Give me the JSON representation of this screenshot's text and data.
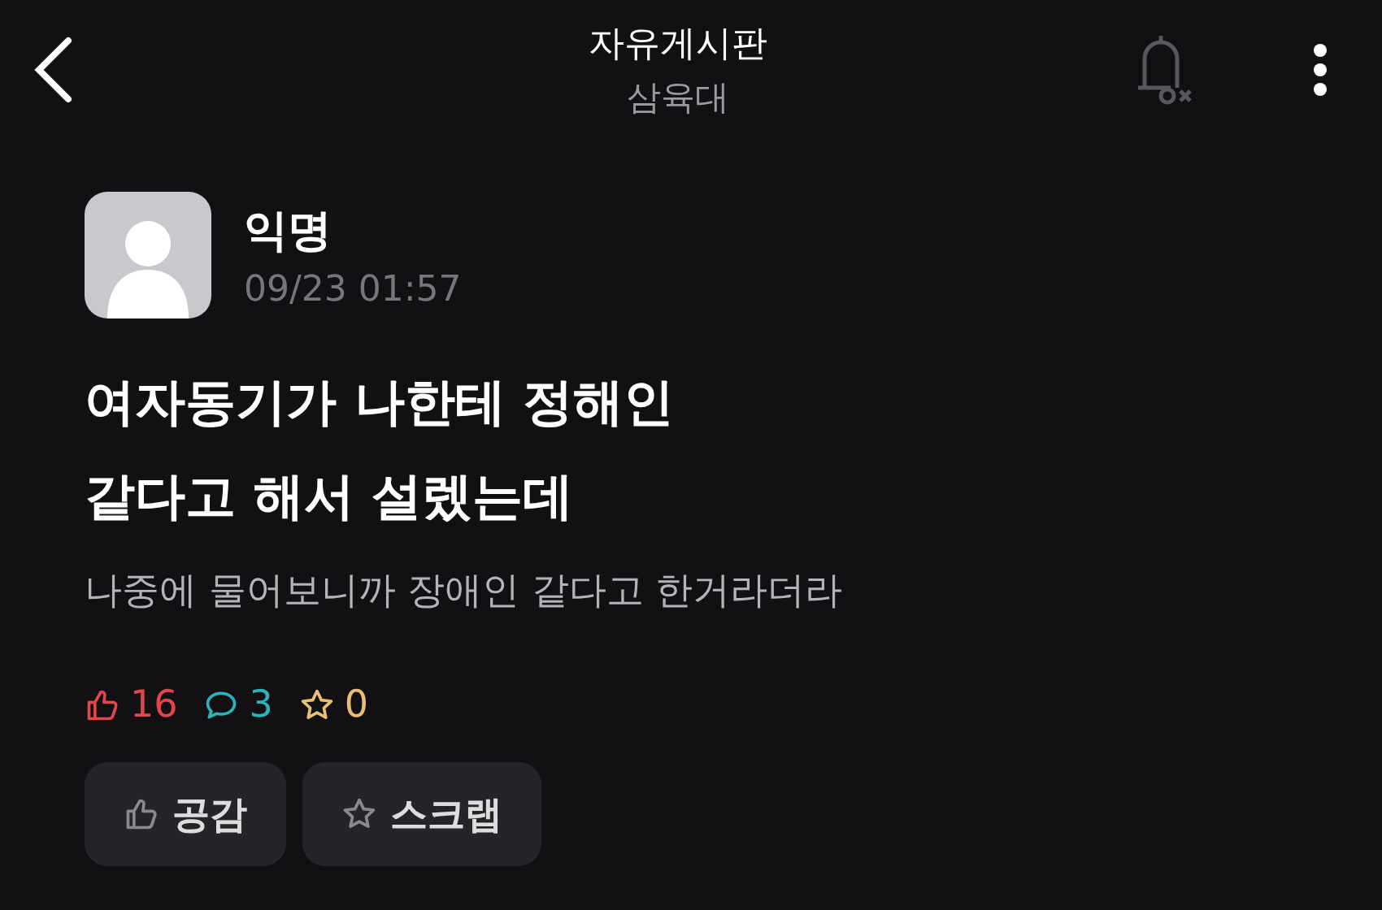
{
  "header": {
    "title": "자유게시판",
    "subtitle": "삼육대"
  },
  "post": {
    "author": "익명",
    "time": "09/23 01:57",
    "title_lines": [
      "여자동기가 나한테 정해인",
      "같다고 해서 설렜는데"
    ],
    "body": "나중에 물어보니까 장애인 같다고 한거라더라",
    "stats": [
      {
        "kind": "like",
        "count": "16",
        "color": "#e0474c"
      },
      {
        "kind": "comment",
        "count": "3",
        "color": "#2bb3b8"
      },
      {
        "kind": "scrap",
        "count": "0",
        "color": "#e8c074"
      }
    ],
    "buttons": [
      {
        "kind": "like",
        "label": "공감"
      },
      {
        "kind": "scrap",
        "label": "스크랩"
      }
    ]
  }
}
